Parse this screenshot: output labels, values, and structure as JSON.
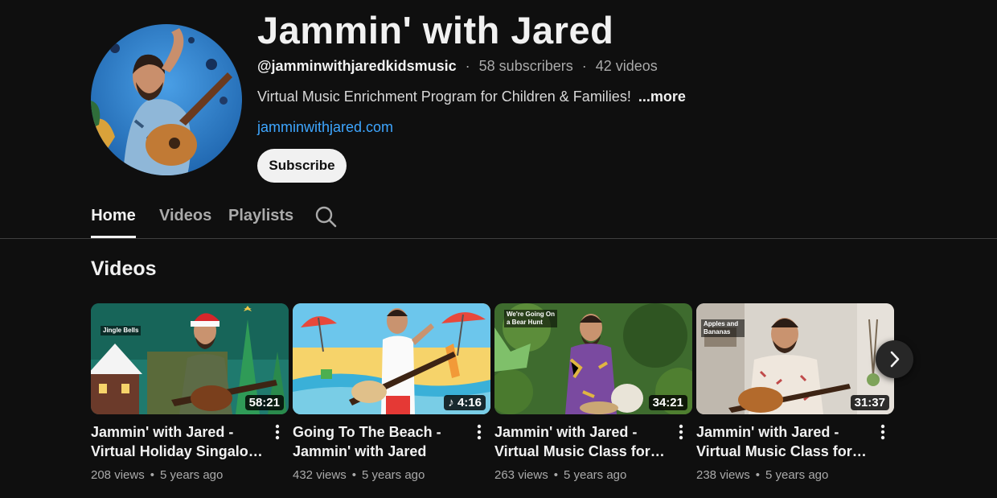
{
  "channel": {
    "name": "Jammin' with Jared",
    "handle": "@jamminwithjaredkidsmusic",
    "subscribers": "58 subscribers",
    "video_count": "42 videos",
    "separator": "·",
    "description": "Virtual Music Enrichment Program for Children & Families!",
    "more_label": "...more",
    "link": "jamminwithjared.com",
    "subscribe_label": "Subscribe"
  },
  "tabs": [
    {
      "label": "Home",
      "active": true
    },
    {
      "label": "Videos",
      "active": false
    },
    {
      "label": "Playlists",
      "active": false
    }
  ],
  "section": {
    "title": "Videos"
  },
  "videos": [
    {
      "title": "Jammin' with Jared - Virtual Holiday Singalong For Kids! …",
      "duration": "58:21",
      "views": "208 views",
      "age": "5 years ago",
      "thumb_text": "Jingle Bells"
    },
    {
      "title": "Going To The Beach - Jammin' with Jared",
      "duration": "4:16",
      "views": "432 views",
      "age": "5 years ago",
      "thumb_text": ""
    },
    {
      "title": "Jammin' with Jared - Virtual Music Class for Kids! …",
      "duration": "34:21",
      "views": "263 views",
      "age": "5 years ago",
      "thumb_text": "We're Going On a Bear Hunt"
    },
    {
      "title": "Jammin' with Jared - Virtual Music Class for Kids! …",
      "duration": "31:37",
      "views": "238 views",
      "age": "5 years ago",
      "thumb_text": "Apples and Bananas"
    }
  ],
  "meta_dot": "•",
  "icons": {
    "search": "search-icon",
    "more": "more-vert-icon",
    "next": "chevron-right-icon",
    "music_note": "music-note-icon"
  },
  "colors": {
    "background": "#0f0f0f",
    "link": "#3ea6ff",
    "subscribe_bg": "#f1f1f1"
  }
}
